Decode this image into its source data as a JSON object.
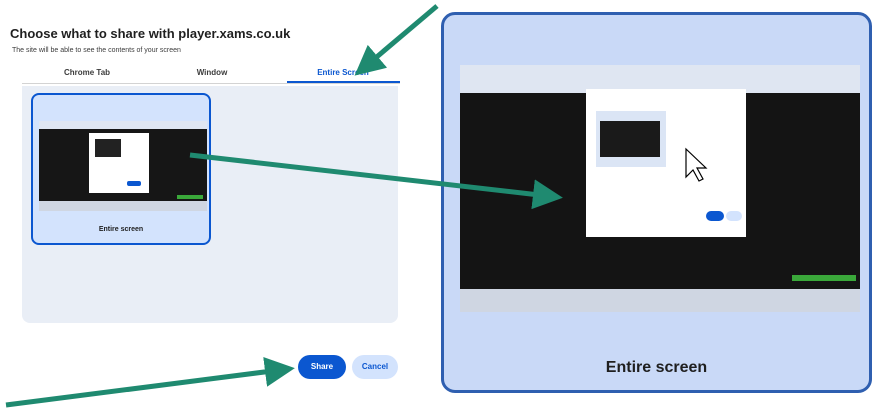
{
  "dialog": {
    "title": "Choose what to share with player.xams.co.uk",
    "subtitle": "The site will be able to see the contents of your screen",
    "tabs": [
      {
        "label": "Chrome Tab",
        "active": false
      },
      {
        "label": "Window",
        "active": false
      },
      {
        "label": "Entire Screen",
        "active": true
      }
    ],
    "source_label": "Entire screen",
    "share_label": "Share",
    "cancel_label": "Cancel"
  },
  "zoom": {
    "label": "Entire screen"
  },
  "colors": {
    "accent": "#0b57d0",
    "arrow": "#1f8a70",
    "selected_bg": "#d3e3fd"
  }
}
